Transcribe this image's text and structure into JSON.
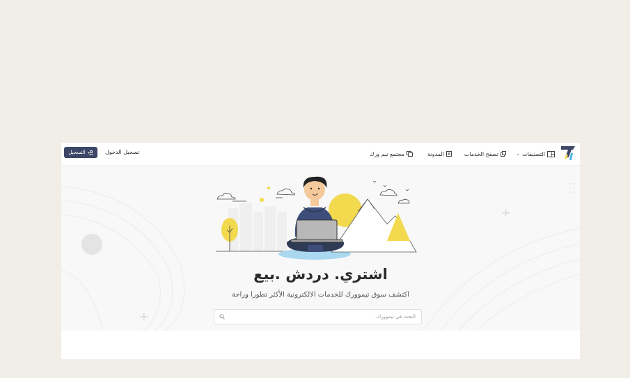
{
  "navbar": {
    "categories_label": "التصنيفات",
    "browse_services_label": "تصفح الخدمات",
    "blog_label": "المدونة",
    "community_label": "مجتمع تيم ورك",
    "login_label": "تسجيل الدخول",
    "signup_label": "التسجيل"
  },
  "hero": {
    "headline": "اشتري. دردش .بيع",
    "subline": "اكتشف سوق تيموورك للخدمات الالكترونية الأكثر تطورا وراحة",
    "search_placeholder": "البحث في تيموورك..",
    "search_value": ""
  },
  "colors": {
    "primary": "#3d4666",
    "accent_yellow": "#f3d94e",
    "accent_blue": "#a9d8f0"
  },
  "icons": [
    "logo-icon",
    "categories-icon",
    "services-icon",
    "blog-icon",
    "community-icon",
    "user-plus-icon",
    "search-icon"
  ]
}
